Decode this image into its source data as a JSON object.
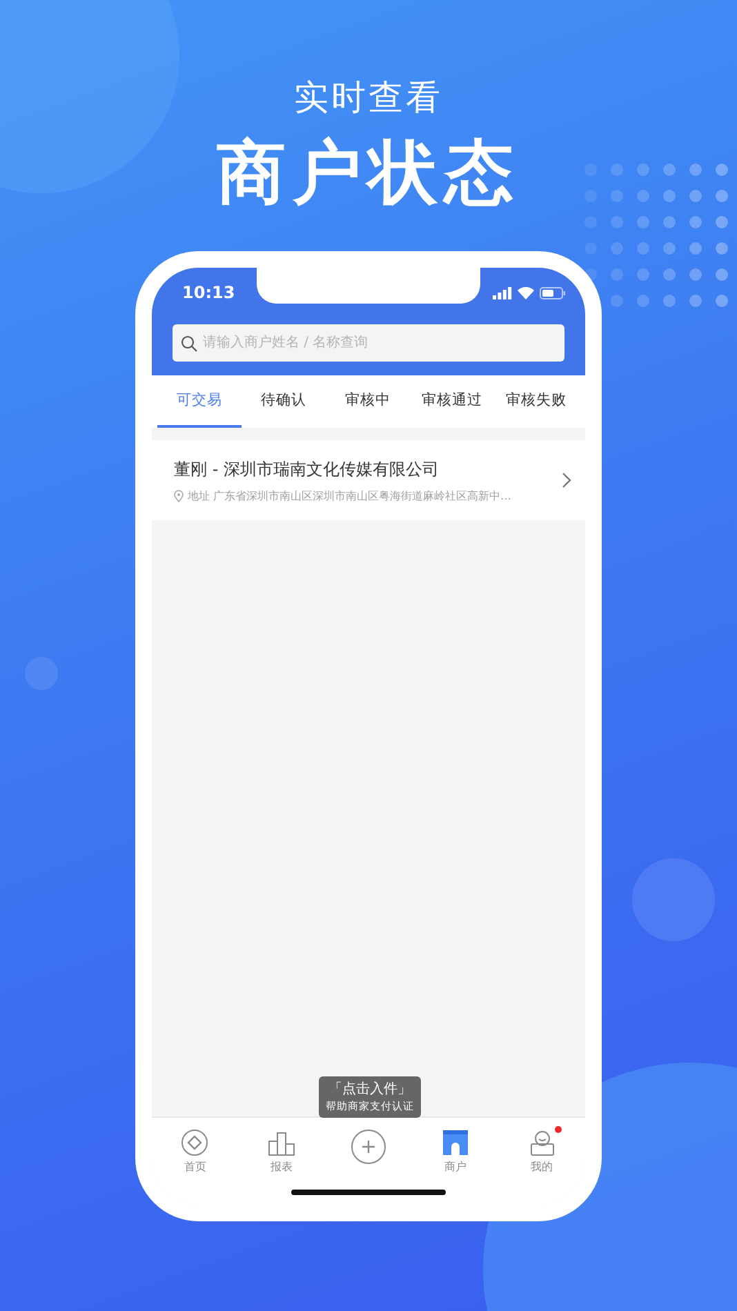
{
  "headline": {
    "subtitle": "实时查看",
    "title": "商户状态"
  },
  "status_bar": {
    "time": "10:13"
  },
  "search": {
    "placeholder": "请输入商户姓名 / 名称查询"
  },
  "tabs": [
    {
      "label": "可交易",
      "selected": true
    },
    {
      "label": "待确认",
      "selected": false
    },
    {
      "label": "审核中",
      "selected": false
    },
    {
      "label": "审核通过",
      "selected": false
    },
    {
      "label": "审核失败",
      "selected": false
    }
  ],
  "merchants": [
    {
      "name": "董刚 - 深圳市瑞南文化传媒有限公司",
      "address_label": "地址",
      "address": "广东省深圳市南山区深圳市南山区粤海街道麻岭社区高新中…"
    }
  ],
  "tooltip": {
    "title": "「点击入件」",
    "text": "帮助商家支付认证"
  },
  "nav": [
    {
      "kind": "home",
      "label": "首页",
      "selected": false,
      "badge": false
    },
    {
      "kind": "report",
      "label": "报表",
      "selected": false,
      "badge": false
    },
    {
      "kind": "add",
      "selected": false,
      "badge": false
    },
    {
      "kind": "merchant",
      "label": "商户",
      "selected": true,
      "badge": false
    },
    {
      "kind": "profile",
      "label": "我的",
      "selected": false,
      "badge": true
    }
  ]
}
